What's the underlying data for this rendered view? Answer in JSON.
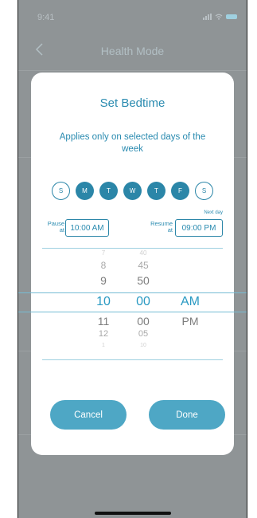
{
  "status": {
    "time": "9:41"
  },
  "nav": {
    "title": "Health Mode"
  },
  "modal": {
    "title": "Set Bedtime",
    "subtitle": "Applies only on selected days of the week",
    "days": [
      {
        "label": "S",
        "selected": false
      },
      {
        "label": "M",
        "selected": true
      },
      {
        "label": "T",
        "selected": true
      },
      {
        "label": "W",
        "selected": true
      },
      {
        "label": "T",
        "selected": true
      },
      {
        "label": "F",
        "selected": true
      },
      {
        "label": "S",
        "selected": false
      }
    ],
    "pause_label": "Pause at",
    "pause_value": "10:00 AM",
    "resume_label": "Resume at",
    "resume_value": "09:00 PM",
    "resume_note": "Next day",
    "picker": {
      "hours": [
        "7",
        "8",
        "9",
        "10",
        "11",
        "12",
        "1"
      ],
      "minutes": [
        "40",
        "45",
        "50",
        "00",
        "00",
        "05",
        "10"
      ],
      "periods": [
        "AM",
        "PM"
      ],
      "selected": {
        "hour": "10",
        "minute": "00",
        "period": "AM"
      }
    },
    "cancel_label": "Cancel",
    "done_label": "Done"
  },
  "colors": {
    "accent": "#2b86a8",
    "button": "#4ea7c5",
    "overlay": "#8f9496"
  }
}
